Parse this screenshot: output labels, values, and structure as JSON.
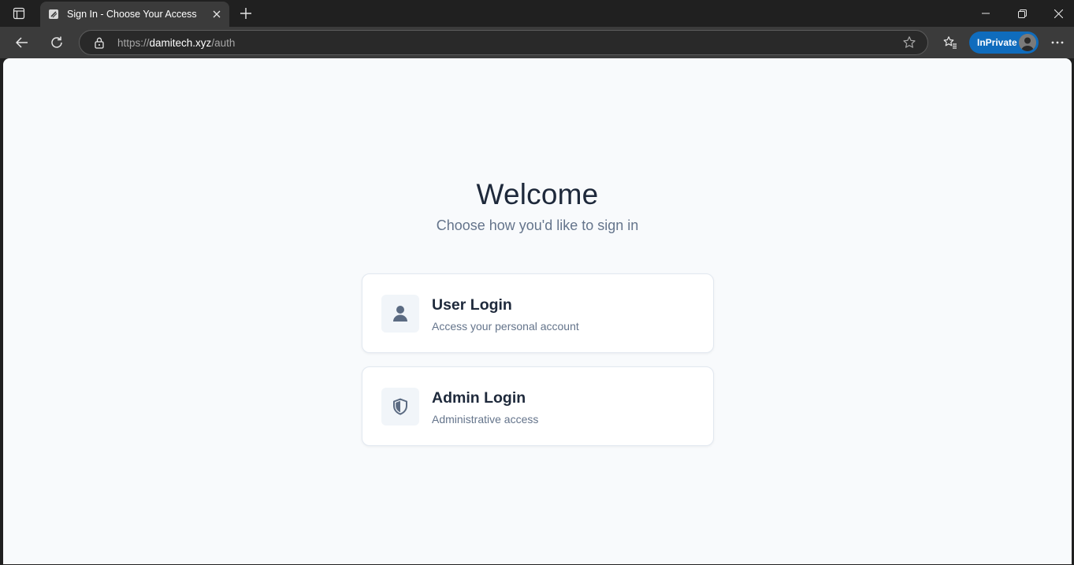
{
  "browser": {
    "tab": {
      "title": "Sign In - Choose Your Access"
    },
    "address": {
      "url_prefix": "https://",
      "url_host": "damitech.xyz",
      "url_path": "/auth"
    },
    "inprivate_label": "InPrivate",
    "accent_color": "#0f6cbd"
  },
  "page": {
    "heading": "Welcome",
    "subheading": "Choose how you'd like to sign in",
    "options": [
      {
        "title": "User Login",
        "description": "Access your personal account",
        "icon": "user-icon"
      },
      {
        "title": "Admin Login",
        "description": "Administrative access",
        "icon": "shield-icon"
      }
    ]
  }
}
